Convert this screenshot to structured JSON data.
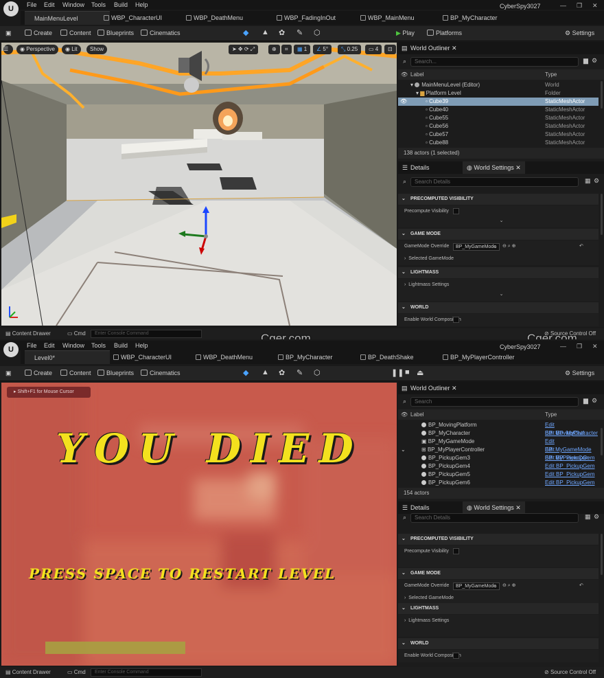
{
  "user": "CyberSpy3027",
  "menu": [
    "File",
    "Edit",
    "Window",
    "Tools",
    "Build",
    "Help"
  ],
  "top": {
    "tabs": [
      "MainMenuLevel",
      "WBP_CharacterUI",
      "WBP_DeathMenu",
      "WBP_FadingInOut",
      "WBP_MainMenu",
      "BP_MyCharacter"
    ],
    "toolbar": {
      "create": "Create",
      "content": "Content",
      "blueprints": "Blueprints",
      "cinematics": "Cinematics",
      "play": "Play",
      "platforms": "Platforms",
      "settings": "Settings"
    },
    "viewport": {
      "perspective": "Perspective",
      "lit": "Lit",
      "show": "Show",
      "grid": "1",
      "angle": "5°",
      "scale": "0.25",
      "cam": "4"
    },
    "outliner": {
      "title": "World Outliner",
      "search": "Search...",
      "col_label": "Label",
      "col_type": "Type",
      "rows": [
        {
          "label": "MainMenuLevel (Editor)",
          "type": "World"
        },
        {
          "label": "Platform Level",
          "type": "Folder"
        },
        {
          "label": "Cube39",
          "type": "StaticMeshActor"
        },
        {
          "label": "Cube40",
          "type": "StaticMeshActor"
        },
        {
          "label": "Cube55",
          "type": "StaticMeshActor"
        },
        {
          "label": "Cube56",
          "type": "StaticMeshActor"
        },
        {
          "label": "Cube57",
          "type": "StaticMeshActor"
        },
        {
          "label": "Cube88",
          "type": "StaticMeshActor"
        }
      ],
      "count": "138 actors (1 selected)"
    }
  },
  "bottom": {
    "tabs": [
      "Level0*",
      "WBP_CharacterUI",
      "WBP_DeathMenu",
      "BP_MyCharacter",
      "BP_DeathShake",
      "BP_MyPlayerController"
    ],
    "hint": "Shift+F1 for Mouse Cursor",
    "death_title": "YOU DIED",
    "death_sub": "PRESS SPACE TO RESTART LEVEL",
    "outliner": {
      "title": "World Outliner",
      "search": "Search",
      "col_label": "Label",
      "col_type": "Type",
      "rows": [
        {
          "label": "BP_MovingPlatform",
          "type": "Edit BP_MovingPlatf..."
        },
        {
          "label": "BP_MyCharacter",
          "type": "Edit BP_MyCharacter"
        },
        {
          "label": "BP_MyGameMode",
          "type": "Edit BP_MyGameMode"
        },
        {
          "label": "BP_MyPlayerController",
          "type": "Edit BP_MyPlayerCon"
        },
        {
          "label": "BP_PickupGem3",
          "type": "Edit BP_PickupGem"
        },
        {
          "label": "BP_PickupGem4",
          "type": "Edit BP_PickupGem"
        },
        {
          "label": "BP_PickupGem5",
          "type": "Edit BP_PickupGem"
        },
        {
          "label": "BP_PickupGem6",
          "type": "Edit BP_PickupGem"
        }
      ],
      "count": "154 actors"
    }
  },
  "details": {
    "tab_details": "Details",
    "tab_world": "World Settings",
    "search": "Search Details",
    "precomputed": "PRECOMPUTED VISIBILITY",
    "precompute": "Precompute Visibility",
    "gamemode": "GAME MODE",
    "override": "GameMode Override",
    "override_val": "BP_MyGameMode",
    "selected": "Selected GameMode",
    "lightmass": "LIGHTMASS",
    "lightmass_settings": "Lightmass Settings",
    "world": "WORLD",
    "world_comp": "Enable World Composition"
  },
  "status": {
    "drawer": "Content Drawer",
    "cmd": "Cmd",
    "console": "Enter Console Command",
    "source": "Source Control Off"
  },
  "watermark": "Cger.com"
}
